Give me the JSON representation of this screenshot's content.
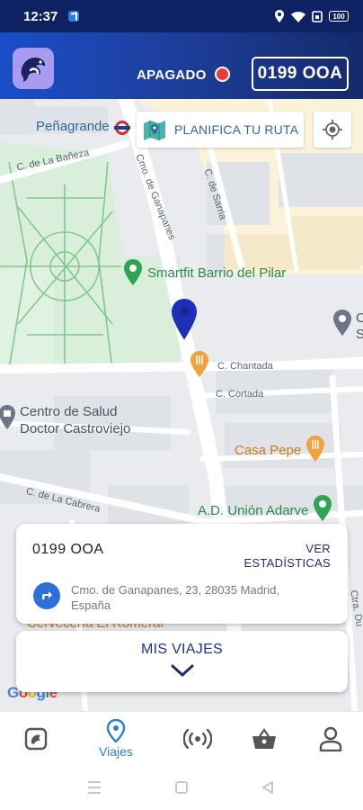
{
  "status_bar": {
    "time": "12:37",
    "battery": "100"
  },
  "header": {
    "device_status": "APAGADO",
    "plate": "0199 OOA",
    "status_color": "#e53e3e"
  },
  "map": {
    "station": "Peñagrande",
    "plan_route": "PLANIFICA TU RUTA",
    "streets": {
      "banezas": "C. de La Bañeza",
      "ganapanes": "Cmo. de Ganapanes",
      "sarria": "C. de Sarria",
      "chantada": "C. Chantada",
      "cortada": "C. Cortada",
      "cabrera": "C. de La Cabrera",
      "right_edge": "Ctra. Du"
    },
    "pois": {
      "gym": "Smartfit Barrio del Pilar",
      "health_center_line1": "Centro de Salud",
      "health_center_line2": "Doctor Castroviejo",
      "restaurant": "Casa Pepe",
      "club": "A.D. Unión Adarve",
      "partial_right_1": "C",
      "partial_right_2": "S",
      "hidden_poi": "Cervecería El Romeral"
    },
    "attribution": "Google"
  },
  "info_card": {
    "plate": "0199 OOA",
    "stats_line1": "VER",
    "stats_line2": "ESTADÍSTICAS",
    "address": "Cmo. de Ganapanes, 23, 28035 Madrid, España"
  },
  "trips_card": {
    "label": "MIS VIAJES"
  },
  "bottom_nav": {
    "items": [
      {
        "icon": "home-logo-icon",
        "label": ""
      },
      {
        "icon": "location-pin-icon",
        "label": "Viajes"
      },
      {
        "icon": "broadcast-icon",
        "label": ""
      },
      {
        "icon": "shopping-basket-icon",
        "label": ""
      },
      {
        "icon": "user-profile-icon",
        "label": ""
      }
    ],
    "active_color": "#2d7fd6"
  }
}
